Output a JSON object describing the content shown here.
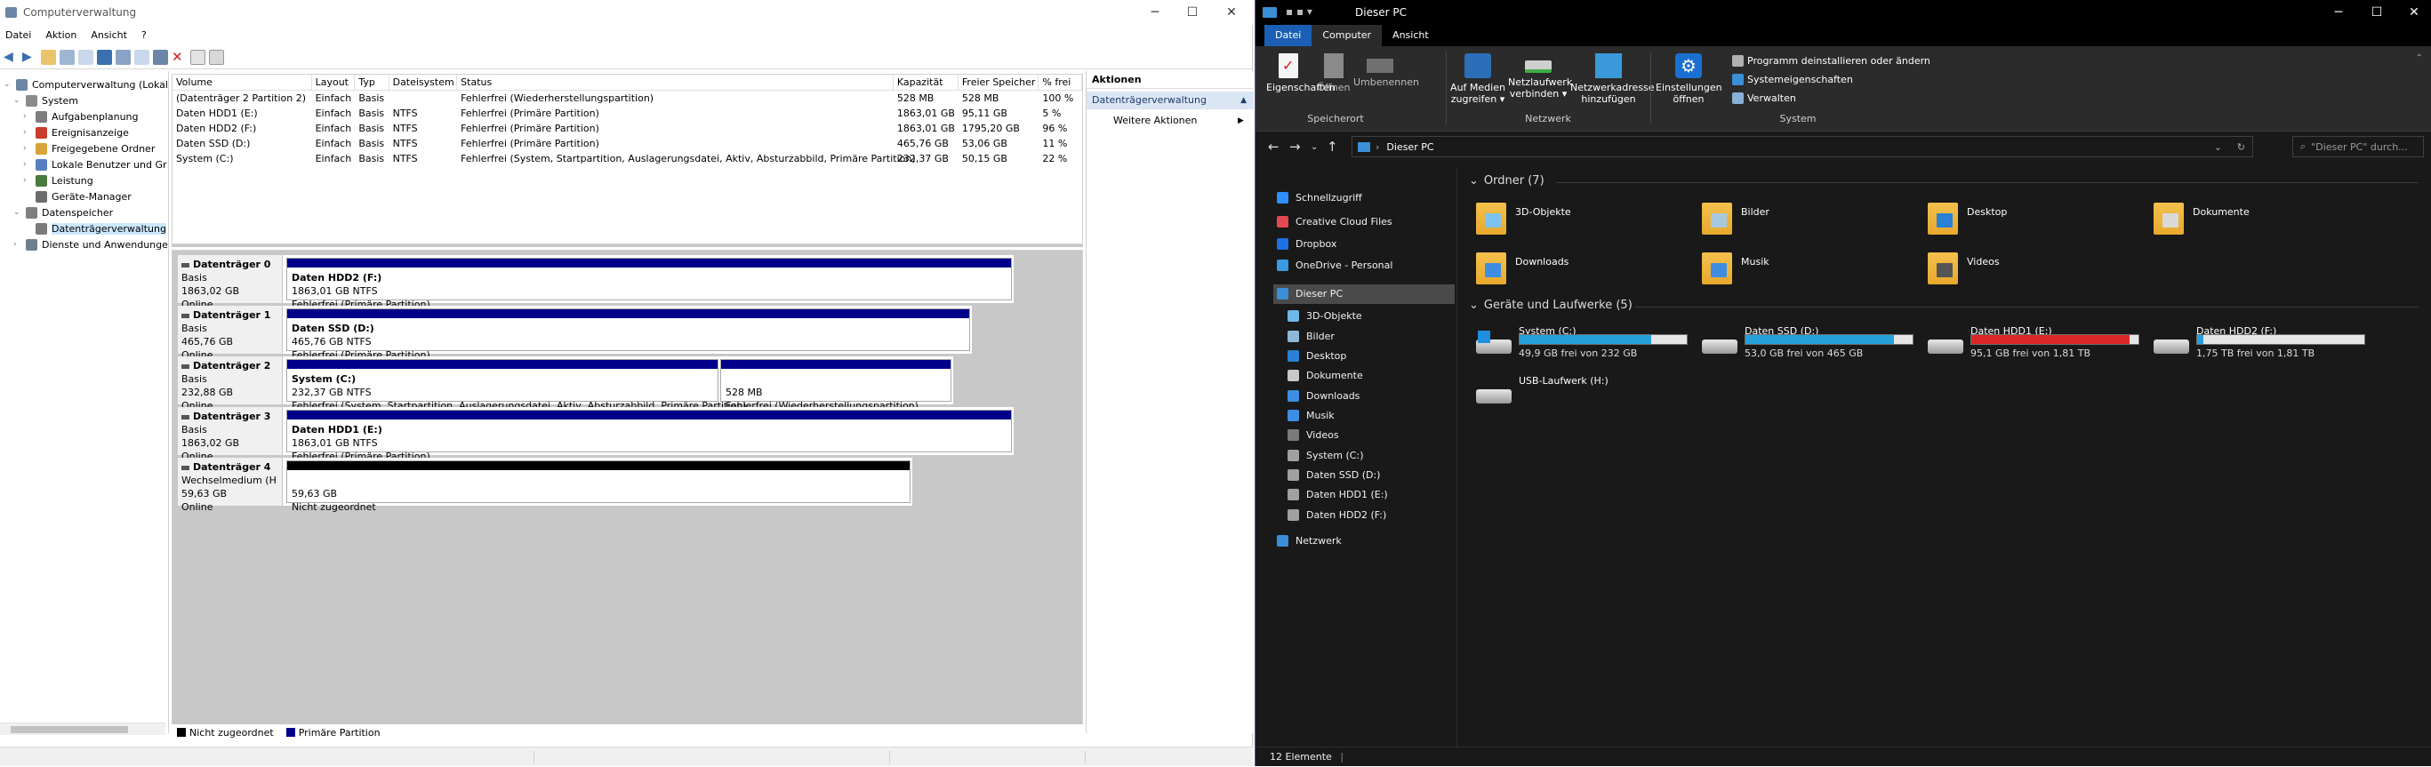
{
  "left": {
    "title": "Computerverwaltung",
    "menu": [
      "Datei",
      "Aktion",
      "Ansicht",
      "?"
    ],
    "tree": [
      {
        "label": "Computerverwaltung (Lokal)",
        "level": 0,
        "exp": "v",
        "icon": "#6b86a6"
      },
      {
        "label": "System",
        "level": 1,
        "exp": "v",
        "icon": "#8a8a8a"
      },
      {
        "label": "Aufgabenplanung",
        "level": 2,
        "exp": ">",
        "icon": "#7d7d7d"
      },
      {
        "label": "Ereignisanzeige",
        "level": 2,
        "exp": ">",
        "icon": "#c83c2c"
      },
      {
        "label": "Freigegebene Ordner",
        "level": 2,
        "exp": ">",
        "icon": "#d7a33a"
      },
      {
        "label": "Lokale Benutzer und Gr",
        "level": 2,
        "exp": ">",
        "icon": "#5a7fc1"
      },
      {
        "label": "Leistung",
        "level": 2,
        "exp": ">",
        "icon": "#4a7a3c"
      },
      {
        "label": "Geräte-Manager",
        "level": 2,
        "exp": "",
        "icon": "#6c6c6c"
      },
      {
        "label": "Datenspeicher",
        "level": 1,
        "exp": "v",
        "icon": "#7f7f7f"
      },
      {
        "label": "Datenträgerverwaltung",
        "level": 2,
        "exp": "",
        "icon": "#7a7a7a",
        "sel": true
      },
      {
        "label": "Dienste und Anwendungen",
        "level": 1,
        "exp": ">",
        "icon": "#6f7f8f"
      }
    ],
    "columns": [
      "Volume",
      "Layout",
      "Typ",
      "Dateisystem",
      "Status",
      "Kapazität",
      "Freier Speicher",
      "% frei"
    ],
    "rows": [
      [
        "(Datenträger 2 Partition 2)",
        "Einfach",
        "Basis",
        "",
        "Fehlerfrei (Wiederherstellungspartition)",
        "528 MB",
        "528 MB",
        "100 %"
      ],
      [
        "Daten HDD1 (E:)",
        "Einfach",
        "Basis",
        "NTFS",
        "Fehlerfrei (Primäre Partition)",
        "1863,01 GB",
        "95,11 GB",
        "5 %"
      ],
      [
        "Daten HDD2 (F:)",
        "Einfach",
        "Basis",
        "NTFS",
        "Fehlerfrei (Primäre Partition)",
        "1863,01 GB",
        "1795,20 GB",
        "96 %"
      ],
      [
        "Daten SSD (D:)",
        "Einfach",
        "Basis",
        "NTFS",
        "Fehlerfrei (Primäre Partition)",
        "465,76 GB",
        "53,06 GB",
        "11 %"
      ],
      [
        "System (C:)",
        "Einfach",
        "Basis",
        "NTFS",
        "Fehlerfrei (System, Startpartition, Auslagerungsdatei, Aktiv, Absturzabbild, Primäre Partition)",
        "232,37 GB",
        "50,15 GB",
        "22 %"
      ]
    ],
    "disks": [
      {
        "name": "Datenträger 0",
        "type": "Basis",
        "size": "1863,02 GB",
        "state": "Online",
        "parts": [
          {
            "title": "Daten HDD2  (F:)",
            "size": "1863,01 GB NTFS",
            "status": "Fehlerfrei (Primäre Partition)",
            "kind": "primary"
          }
        ]
      },
      {
        "name": "Datenträger 1",
        "type": "Basis",
        "size": "465,76 GB",
        "state": "Online",
        "parts": [
          {
            "title": "Daten SSD  (D:)",
            "size": "465,76 GB NTFS",
            "status": "Fehlerfrei (Primäre Partition)",
            "kind": "primary"
          }
        ]
      },
      {
        "name": "Datenträger 2",
        "type": "Basis",
        "size": "232,88 GB",
        "state": "Online",
        "parts": [
          {
            "title": "System  (C:)",
            "size": "232,37 GB NTFS",
            "status": "Fehlerfrei (System, Startpartition, Auslagerungsdatei, Aktiv, Absturzabbild, Primäre Partition)",
            "kind": "primary"
          },
          {
            "title": "",
            "size": "528 MB",
            "status": "Fehlerfrei (Wiederherstellungspartition)",
            "kind": "primary"
          }
        ]
      },
      {
        "name": "Datenträger 3",
        "type": "Basis",
        "size": "1863,02 GB",
        "state": "Online",
        "parts": [
          {
            "title": "Daten HDD1  (E:)",
            "size": "1863,01 GB NTFS",
            "status": "Fehlerfrei (Primäre Partition)",
            "kind": "primary"
          }
        ]
      },
      {
        "name": "Datenträger 4",
        "type": "Wechselmedium (H",
        "size": "59,63 GB",
        "state": "Online",
        "parts": [
          {
            "title": "",
            "size": "59,63 GB",
            "status": "Nicht zugeordnet",
            "kind": "unalloc"
          }
        ]
      }
    ],
    "legend": [
      {
        "label": "Nicht zugeordnet",
        "color": "#000000"
      },
      {
        "label": "Primäre Partition",
        "color": "#00008b"
      }
    ],
    "actions": {
      "header": "Aktionen",
      "section": "Datenträgerverwaltung",
      "more": "Weitere Aktionen"
    }
  },
  "right": {
    "title": "Dieser PC",
    "tabs": [
      "Datei",
      "Computer",
      "Ansicht"
    ],
    "ribbon": {
      "eigenschaften": "Eigenschaften",
      "oeffnen": "Öffnen",
      "umbenennen": "Umbenennen",
      "speicherort": "Speicherort",
      "medien1": "Auf Medien",
      "medien2": "zugreifen ▾",
      "netz1": "Netzlaufwerk",
      "netz2": "verbinden ▾",
      "netzadr1": "Netzwerkadresse",
      "netzadr2": "hinzufügen",
      "netzwerk": "Netzwerk",
      "einst1": "Einstellungen",
      "einst2": "öffnen",
      "prog": "Programm deinstallieren oder ändern",
      "syseig": "Systemeigenschaften",
      "verwalten": "Verwalten",
      "system": "System"
    },
    "address": "Dieser PC",
    "search": "\"Dieser PC\" durch...",
    "nav": [
      {
        "label": "Schnellzugriff",
        "icon": "#2f8fff",
        "indent": 0
      },
      {
        "label": "Creative Cloud Files",
        "icon": "#e34850",
        "indent": 0
      },
      {
        "label": "Dropbox",
        "icon": "#1f6fe5",
        "indent": 0
      },
      {
        "label": "OneDrive - Personal",
        "icon": "#3b9ae1",
        "indent": 0
      },
      {
        "label": "Dieser PC",
        "icon": "#3a8fd6",
        "indent": 0,
        "sel": true
      },
      {
        "label": "3D-Objekte",
        "icon": "#6fb8e8",
        "indent": 1
      },
      {
        "label": "Bilder",
        "icon": "#8fb8d8",
        "indent": 1
      },
      {
        "label": "Desktop",
        "icon": "#2a7fd6",
        "indent": 1
      },
      {
        "label": "Dokumente",
        "icon": "#c8c8c8",
        "indent": 1
      },
      {
        "label": "Downloads",
        "icon": "#3d8ee3",
        "indent": 1
      },
      {
        "label": "Musik",
        "icon": "#3d8ee3",
        "indent": 1
      },
      {
        "label": "Videos",
        "icon": "#7a7a7a",
        "indent": 1
      },
      {
        "label": "System (C:)",
        "icon": "#a0a0a0",
        "indent": 1
      },
      {
        "label": "Daten SSD (D:)",
        "icon": "#a0a0a0",
        "indent": 1
      },
      {
        "label": "Daten HDD1 (E:)",
        "icon": "#a0a0a0",
        "indent": 1
      },
      {
        "label": "Daten HDD2 (F:)",
        "icon": "#a0a0a0",
        "indent": 1
      },
      {
        "label": "Netzwerk",
        "icon": "#3a8fd6",
        "indent": 0
      }
    ],
    "folders_header": "Ordner (7)",
    "folders": [
      "3D-Objekte",
      "Bilder",
      "Desktop",
      "Dokumente",
      "Downloads",
      "Musik",
      "Videos"
    ],
    "drives_header": "Geräte und Laufwerke (5)",
    "drives": [
      {
        "label": "System (C:)",
        "free": "49,9 GB frei von 232 GB",
        "used": 0.785,
        "color": "#26a0da"
      },
      {
        "label": "Daten SSD (D:)",
        "free": "53,0 GB frei von 465 GB",
        "used": 0.886,
        "color": "#26a0da"
      },
      {
        "label": "Daten HDD1 (E:)",
        "free": "95,1 GB frei von 1,81 TB",
        "used": 0.949,
        "color": "#da2626"
      },
      {
        "label": "Daten HDD2 (F:)",
        "free": "1,75 TB frei von 1,81 TB",
        "used": 0.035,
        "color": "#26a0da"
      },
      {
        "label": "USB-Laufwerk (H:)",
        "free": "",
        "used": null,
        "color": ""
      }
    ],
    "status": "12 Elemente"
  }
}
